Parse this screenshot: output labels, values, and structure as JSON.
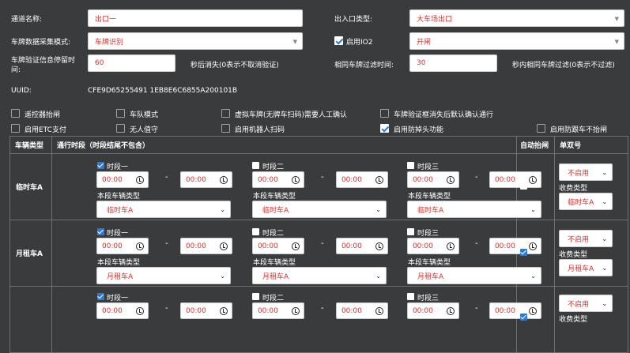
{
  "form": {
    "channel_name_label": "通道名称:",
    "channel_name_value": "出口一",
    "entry_type_label": "出入口类型:",
    "entry_type_value": "大车场出口",
    "plate_mode_label": "车牌数据采集模式:",
    "plate_mode_value": "车牌识别",
    "io2_label": "启用IO2",
    "io2_value": "开闸",
    "stay_time_label": "车牌验证信息停留时间:",
    "stay_time_value": "60",
    "stay_time_suffix": "秒后消失(0表示不取消验证)",
    "filter_time_label": "相同车牌过滤时间:",
    "filter_time_value": "30",
    "filter_time_suffix": "秒内相同车牌过滤(0表示不过滤)",
    "uuid_label": "UUID:",
    "uuid_value": "CFE9D65255491 1EB8E6C6855A200101B"
  },
  "options": [
    {
      "label": "遥控器抬闸",
      "checked": false
    },
    {
      "label": "车队模式",
      "checked": false
    },
    {
      "label": "虚拟车牌(无牌车扫码)需要人工确认",
      "checked": false
    },
    {
      "label": "车牌验证框消失后默认确认通行",
      "checked": false
    },
    {
      "label": "启用ETC支付",
      "checked": false
    },
    {
      "label": "无人值守",
      "checked": false
    },
    {
      "label": "启用机器人扫码",
      "checked": false
    },
    {
      "label": "启用防掉头功能",
      "checked": true
    },
    {
      "label": "启用防跟车不抬闸",
      "checked": false
    }
  ],
  "table": {
    "headers": [
      "车辆类型",
      "通行时段（时段结尾不包含）",
      "自动抬闸",
      "单双号"
    ],
    "period_labels": [
      "时段一",
      "时段二",
      "时段三"
    ],
    "time_placeholder": "00:00",
    "dash": "-",
    "period_type_label": "本段车辆类型",
    "fee_type_label": "收费类型",
    "parity_value": "不启用",
    "rows": [
      {
        "type": "临时车A",
        "vehicle": "临时车A",
        "fee": "临时车A",
        "auto": false
      },
      {
        "type": "月租车A",
        "vehicle": "月租车A",
        "fee": "月租车A",
        "auto": true
      },
      {
        "type": "",
        "vehicle": "",
        "fee": "",
        "auto": true
      }
    ]
  },
  "colors": {
    "accent": "#d9302c",
    "background": "#3a3b3d",
    "check": "#2a7ade"
  }
}
